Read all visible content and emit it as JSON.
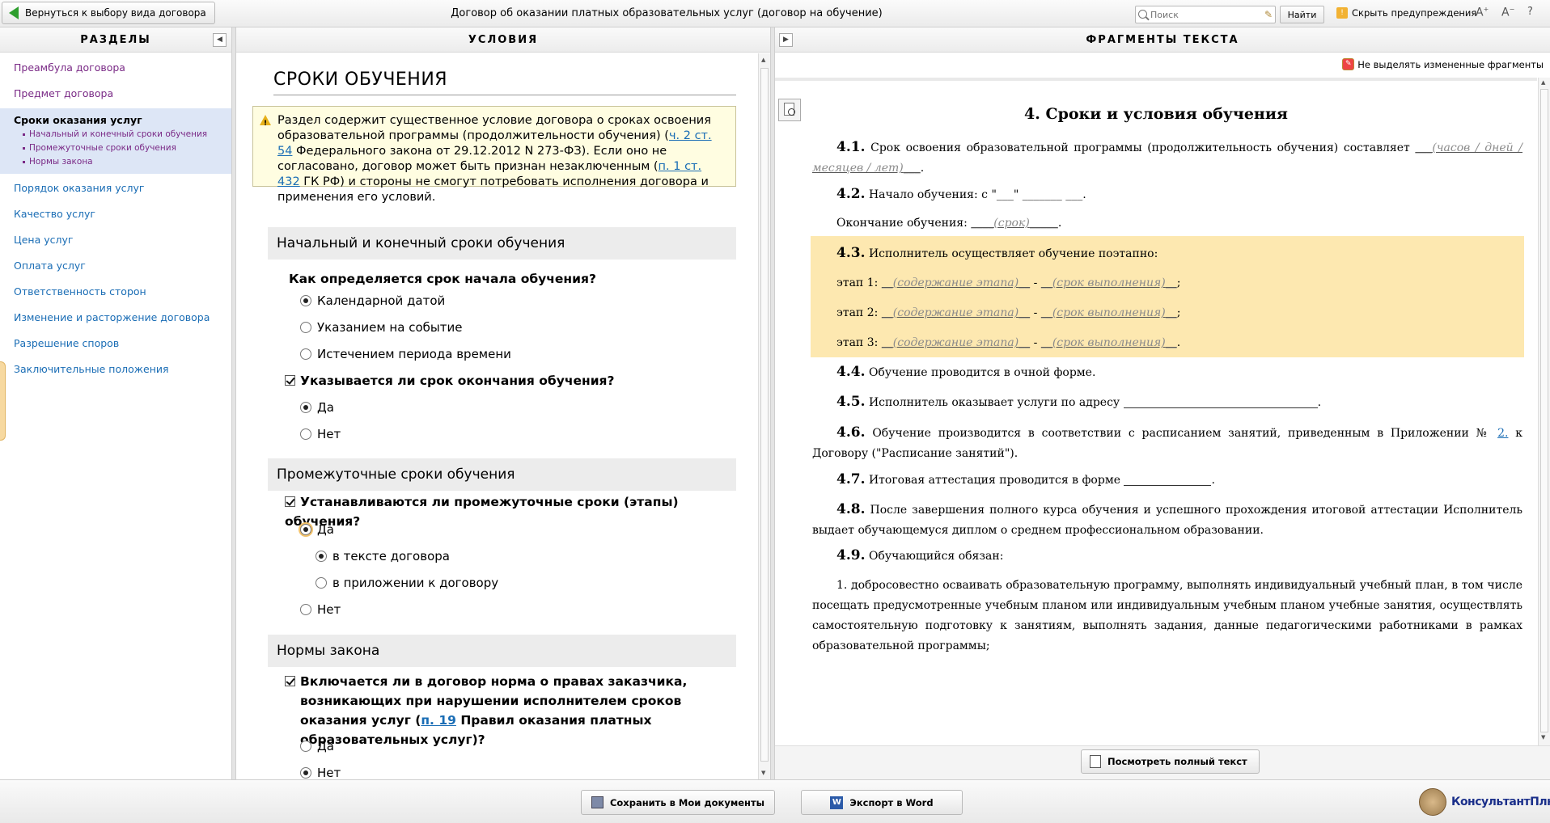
{
  "topbar": {
    "back_label": "Вернуться к выбору вида договора",
    "title": "Договор об оказании платных образовательных услуг (договор на обучение)",
    "search_placeholder": "Поиск",
    "find_label": "Найти",
    "hide_warnings_label": "Скрыть предупреждения"
  },
  "panels": {
    "left_title": "РАЗДЕЛЫ",
    "mid_title": "УСЛОВИЯ",
    "right_title": "ФРАГМЕНТЫ ТЕКСТА"
  },
  "sidebar": {
    "items_before": [
      {
        "label": "Преамбула договора"
      },
      {
        "label": "Предмет договора"
      }
    ],
    "active": {
      "label": "Сроки оказания услуг",
      "subs": [
        "Начальный и конечный сроки обучения",
        "Промежуточные сроки обучения",
        "Нормы закона"
      ]
    },
    "items_after": [
      {
        "label": "Порядок оказания услуг"
      },
      {
        "label": "Качество услуг"
      },
      {
        "label": "Цена услуг"
      },
      {
        "label": "Оплата услуг"
      },
      {
        "label": "Ответственность сторон"
      },
      {
        "label": "Изменение и расторжение договора"
      },
      {
        "label": "Разрешение споров"
      },
      {
        "label": "Заключительные положения"
      }
    ]
  },
  "conditions": {
    "section_title": "СРОКИ ОБУЧЕНИЯ",
    "warning": {
      "t1": "Раздел содержит существенное условие договора о сроках освоения образовательной программы (продолжительности обучения) (",
      "link1": "ч. 2 ст. 54",
      "t2": " Федерального закона от 29.12.2012 N 273-ФЗ). Если оно не согласовано, договор может быть признан незаключенным (",
      "link2": "п. 1 ст. 432",
      "t3": " ГК РФ) и стороны не смогут потребовать исполнения договора и применения его условий."
    },
    "block1": {
      "title": "Начальный и конечный сроки обучения",
      "q1": "Как определяется срок начала обучения?",
      "q1_options": [
        "Календарной датой",
        "Указанием на событие",
        "Истечением периода времени"
      ],
      "q2": "Указывается ли срок окончания обучения?",
      "q2_options": [
        "Да",
        "Нет"
      ]
    },
    "block2": {
      "title": "Промежуточные сроки обучения",
      "q": "Устанавливаются ли промежуточные сроки (этапы) обучения?",
      "opt_yes": "Да",
      "sub_options": [
        "в тексте договора",
        "в приложении к договору"
      ],
      "opt_no": "Нет"
    },
    "block3": {
      "title": "Нормы закона",
      "q_part1": "Включается ли в договор норма о правах заказчика, возникающих при нарушении исполнителем сроков оказания услуг (",
      "q_link": "п. 19",
      "q_part2": " Правил оказания платных образовательных услуг)?",
      "options": [
        "Да",
        "Нет"
      ]
    }
  },
  "fragments": {
    "no_highlight_label": "Не выделять измененные фрагменты",
    "heading": "4. Сроки и условия обучения",
    "p41_num": "4.1.",
    "p41_text": "Срок освоения образовательной программы (продолжительность обучения) составляет",
    "p41_ph": "(часов / дней / месяцев / лет)",
    "p42_num": "4.2.",
    "p42_text": "Начало обучения: с \"___\" _______ ___.",
    "p42b_text": "Окончание обучения:",
    "p42b_ph": "(срок)",
    "p43_num": "4.3.",
    "p43_text": "Исполнитель осуществляет обучение поэтапно:",
    "stage_labels": [
      "этап 1:",
      "этап 2:",
      "этап 3:"
    ],
    "stage_content_ph": "(содержание этапа)",
    "stage_term_ph": "(срок выполнения)",
    "p44_num": "4.4.",
    "p44_text": "Обучение проводится в очной форме.",
    "p45_num": "4.5.",
    "p45_text": "Исполнитель оказывает услуги по адресу",
    "p46_num": "4.6.",
    "p46_text_a": "Обучение производится в соответствии с расписанием занятий, приведенным в Приложении №",
    "p46_link": "2.",
    "p46_text_b": "к Договору (\"Расписание занятий\").",
    "p47_num": "4.7.",
    "p47_text": "Итоговая аттестация проводится в форме",
    "p48_num": "4.8.",
    "p48_text": "После завершения полного курса обучения и успешного прохождения итоговой аттестации Исполнитель выдает обучающемуся диплом о среднем профессиональном образовании.",
    "p49_num": "4.9.",
    "p49_text": "Обучающийся обязан:",
    "p491_text": "1. добросовестно осваивать образовательную программу, выполнять индивидуальный учебный план, в том числе посещать предусмотренные учебным планом или индивидуальным учебным планом учебные занятия, осуществлять самостоятельную подготовку к занятиям, выполнять задания, данные педагогическими работниками в рамках образовательной программы;",
    "view_full_label": "Посмотреть полный текст"
  },
  "bottombar": {
    "save_label": "Сохранить в Мои документы",
    "export_label": "Экспорт в Word",
    "logo_text": "КонсультантПлюс"
  }
}
